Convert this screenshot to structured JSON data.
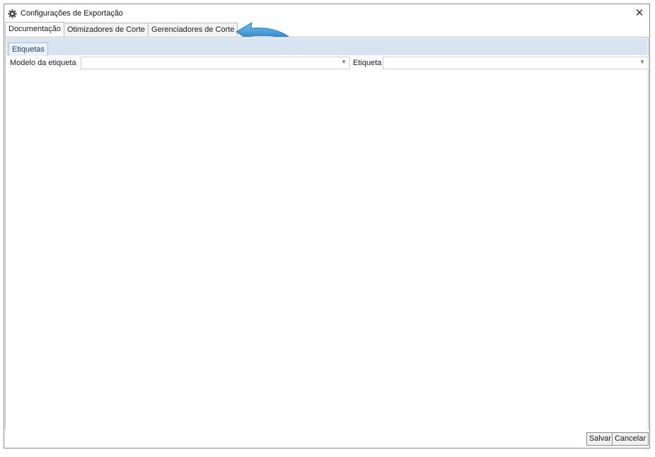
{
  "window": {
    "title": "Configurações de Exportação",
    "close_glyph": "✕",
    "title_icon": "gear-icon"
  },
  "outer_tabs": [
    {
      "label": "Documentação",
      "active": true
    },
    {
      "label": "Otimizadores de Corte",
      "active": false
    },
    {
      "label": "Gerenciadores de Corte",
      "active": false
    }
  ],
  "annotation": {
    "icon": "pointer-arrow-icon",
    "color": "#2d8fd6"
  },
  "inner_tabs": [
    {
      "label": "Etiquetas",
      "active": true
    }
  ],
  "form": {
    "modelo_label": "Modelo da etiqueta",
    "modelo_value": "",
    "etiqueta_label": "Etiqueta",
    "etiqueta_value": "",
    "dropdown_glyph": "▼"
  },
  "footer": {
    "save_label": "Salvar",
    "cancel_label": "Cancelar"
  },
  "colors": {
    "inner_strip": "#d6e4f2",
    "inner_tab_text": "#1d3f73",
    "border": "#b9b9b9"
  }
}
